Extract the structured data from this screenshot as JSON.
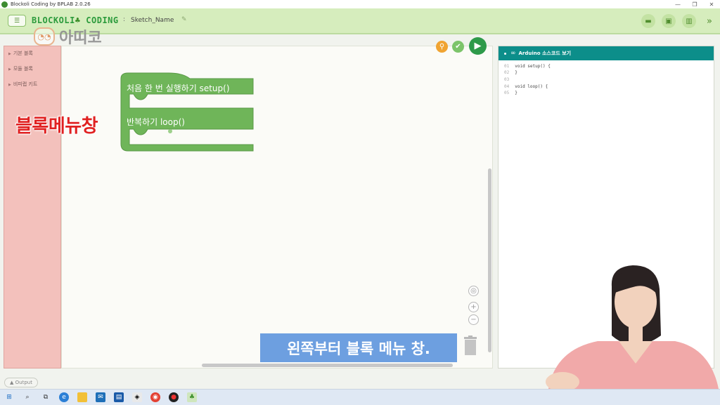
{
  "window": {
    "title": "Blockoli Coding by BPLAB 2.0.26",
    "minimize_glyph": "—",
    "restore_glyph": "❐",
    "close_glyph": "✕"
  },
  "toolbar": {
    "menu_icon": "list-menu-icon",
    "brand": "BLOCKOLI",
    "brand2": "CODING",
    "separator": ":",
    "sketch_name": "Sketch_Name",
    "watermark": "아띠코",
    "actions": [
      "open-folder-icon",
      "save-icon",
      "trash-icon",
      "expand-icon"
    ]
  },
  "categories": [
    {
      "label": "기본 블록"
    },
    {
      "label": "모듈 블록"
    },
    {
      "label": "비피랩 키트"
    }
  ],
  "workspace": {
    "setup_label": "처음 한 번 실행하기 setup()",
    "loop_label": "반복하기 loop()"
  },
  "code_panel": {
    "title": "Arduino 소스코드 보기",
    "lines": [
      {
        "num": "01",
        "code": "void setup() {"
      },
      {
        "num": "02",
        "code": "}"
      },
      {
        "num": "03",
        "code": ""
      },
      {
        "num": "04",
        "code": "void loop() {"
      },
      {
        "num": "05",
        "code": "}"
      }
    ]
  },
  "overlay": {
    "red_label": "블록메뉴창",
    "subtitle": "왼쪽부터 블록 메뉴 창."
  },
  "output_tab": "▲ Output",
  "colors": {
    "toolbar": "#d6edbd",
    "block_green": "#6fb559",
    "code_header": "#0c8e8a",
    "menu_panel": "#f3c1bc",
    "subtitle_bg": "#6d9fe0",
    "red_label": "#e02121"
  }
}
